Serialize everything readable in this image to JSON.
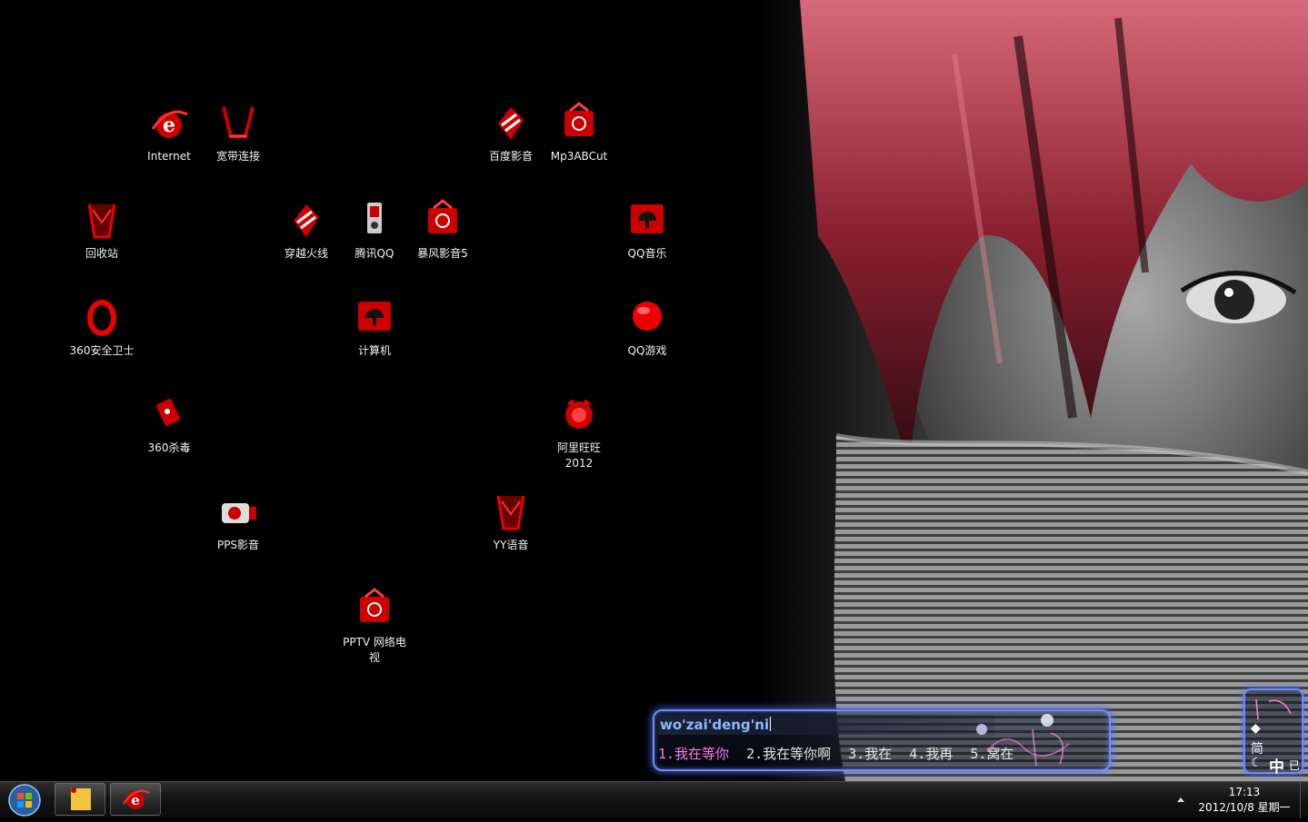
{
  "desktop": {
    "icons": [
      {
        "label": "Internet"
      },
      {
        "label": "宽带连接"
      },
      {
        "label": "百度影音"
      },
      {
        "label": "Mp3ABCut"
      },
      {
        "label": "回收站"
      },
      {
        "label": "穿越火线"
      },
      {
        "label": "腾讯QQ"
      },
      {
        "label": "暴风影音5"
      },
      {
        "label": "QQ音乐"
      },
      {
        "label": "360安全卫士"
      },
      {
        "label": "计算机"
      },
      {
        "label": "QQ游戏"
      },
      {
        "label": "360杀毒"
      },
      {
        "label": "阿里旺旺2012"
      },
      {
        "label": "PPS影音"
      },
      {
        "label": "YY语音"
      },
      {
        "label": "PPTV 网络电视"
      }
    ]
  },
  "ime": {
    "input": "wo'zai'deng'ni",
    "candidates": [
      "1.我在等你",
      "2.我在等你啊",
      "3.我在",
      "4.我再",
      "5.窝在"
    ],
    "status": {
      "mode_simplified": "简",
      "mode_chinese": "中",
      "punct": "已"
    }
  },
  "taskbar": {
    "clock_time": "17:13",
    "clock_date": "2012/10/8 星期一"
  },
  "colors": {
    "accent_red": "#d40000",
    "ime_border": "#6e8cff",
    "candidate_selected": "#ff7ae6"
  }
}
